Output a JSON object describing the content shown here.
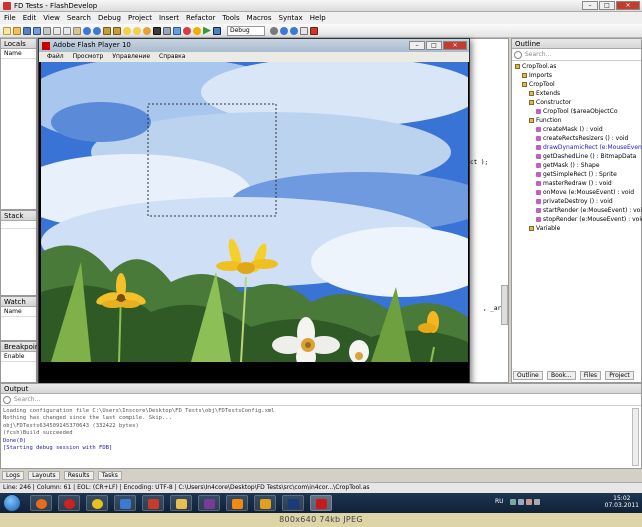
{
  "app": {
    "title": "FD Tests - FlashDevelop"
  },
  "menu": [
    "File",
    "Edit",
    "View",
    "Search",
    "Debug",
    "Project",
    "Insert",
    "Refactor",
    "Tools",
    "Macros",
    "Syntax",
    "Help"
  ],
  "toolbar": {
    "config_value": "Debug"
  },
  "left_panels": {
    "locals": {
      "title": "Locals",
      "column": "Name"
    },
    "stack": {
      "title": "Stack"
    },
    "watch": {
      "title": "Watch",
      "column": "Name"
    },
    "breakpoints": {
      "title": "Breakpoints",
      "column": "Enable"
    }
  },
  "flash_player": {
    "title": "Adobe Flash Player 10",
    "menu": [
      "Файл",
      "Просмотр",
      "Управление",
      "Справка"
    ]
  },
  "editor_fragments": {
    "line_a": "ct );",
    "line_b": ", _are"
  },
  "outline": {
    "title": "Outline",
    "search_placeholder": "Search...",
    "items": [
      {
        "label": "CropTool.as",
        "indent": 0
      },
      {
        "label": "Imports",
        "indent": 1
      },
      {
        "label": "CropTool",
        "indent": 1
      },
      {
        "label": "Extends",
        "indent": 2
      },
      {
        "label": "Constructor",
        "indent": 2
      },
      {
        "label": "CropTool ($areaObjectCo",
        "indent": 3
      },
      {
        "label": "Function",
        "indent": 2
      },
      {
        "label": "createMask () : void",
        "indent": 3
      },
      {
        "label": "createRectsResizers () : void",
        "indent": 3
      },
      {
        "label": "drawDynamicRect (e:MouseEvent",
        "indent": 3
      },
      {
        "label": "getDashedLine () : BitmapData",
        "indent": 3
      },
      {
        "label": "getMask () : Shape",
        "indent": 3
      },
      {
        "label": "getSimpleRect () : Sprite",
        "indent": 3
      },
      {
        "label": "masterRedraw () : void",
        "indent": 3
      },
      {
        "label": "onMove (e:MouseEvent) : void",
        "indent": 3
      },
      {
        "label": "privateDestroy () : void",
        "indent": 3
      },
      {
        "label": "startRender (e:MouseEvent) : void",
        "indent": 3
      },
      {
        "label": "stopRender (e:MouseEvent) : void",
        "indent": 3
      },
      {
        "label": "Variable",
        "indent": 2
      }
    ],
    "tabs": [
      "Outline",
      "Book...",
      "Files",
      "Project"
    ]
  },
  "output": {
    "title": "Output",
    "search_placeholder": "Search...",
    "lines": [
      "Loading configuration file C:\\Users\\Inscore\\Desktop\\FD Tests\\obj\\FDTestsConfig.xml",
      "Nothing has changed since the last compile. Skip...",
      "obj\\FDTests634509145370643 (332422 bytes)",
      "(fcsh)Build succeeded",
      "Done(0)",
      "[Starting debug session with FDB]"
    ],
    "tabs": [
      "Logs",
      "Layouts",
      "Results",
      "Tasks"
    ]
  },
  "status": {
    "text": "Line: 246  |  Column: 61  |  EOL: (CR+LF)  |  Encoding: UTF-8  |  C:\\Users\\In4core\\Desktop\\FD Tests\\src\\com\\in4cor...\\CropTool.as"
  },
  "taskbar": {
    "lang": "RU",
    "time": "15:02",
    "date": "07.03.2011"
  },
  "caption": "800x640  74kb  JPEG"
}
